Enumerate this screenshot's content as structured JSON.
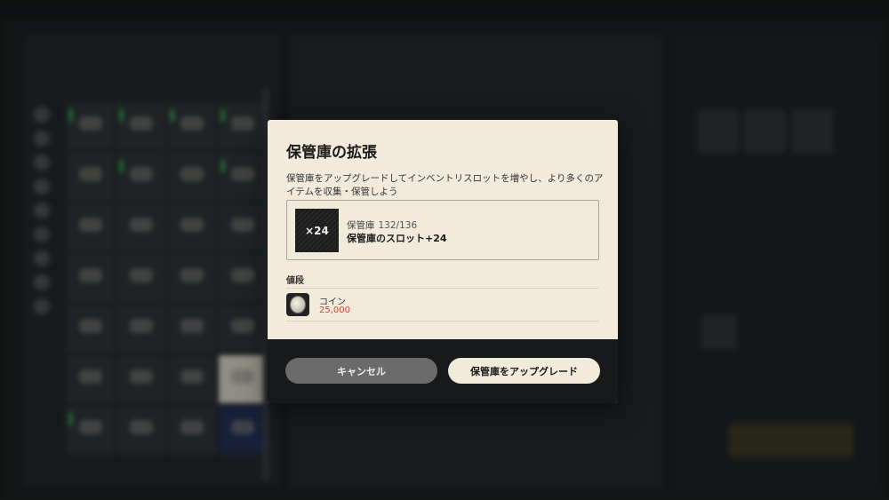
{
  "modal": {
    "title": "保管庫の拡張",
    "description": "保管庫をアップグレードしてインベントリスロットを増やし、より多くのアイテムを収集・保管しよう",
    "slot": {
      "icon_text": "×24",
      "name": "保管庫",
      "count": "132/136",
      "effect": "保管庫のスロット+24"
    },
    "price": {
      "label": "値段",
      "currency_name": "コイン",
      "amount": "25,000",
      "icon": "coin-icon"
    },
    "buttons": {
      "cancel": "キャンセル",
      "upgrade": "保管庫をアップグレード"
    }
  },
  "colors": {
    "modal_bg": "#f2ebdc",
    "footer_bg": "#17191b",
    "cancel_bg": "#6b6b6b",
    "price_red": "#c9473a"
  }
}
